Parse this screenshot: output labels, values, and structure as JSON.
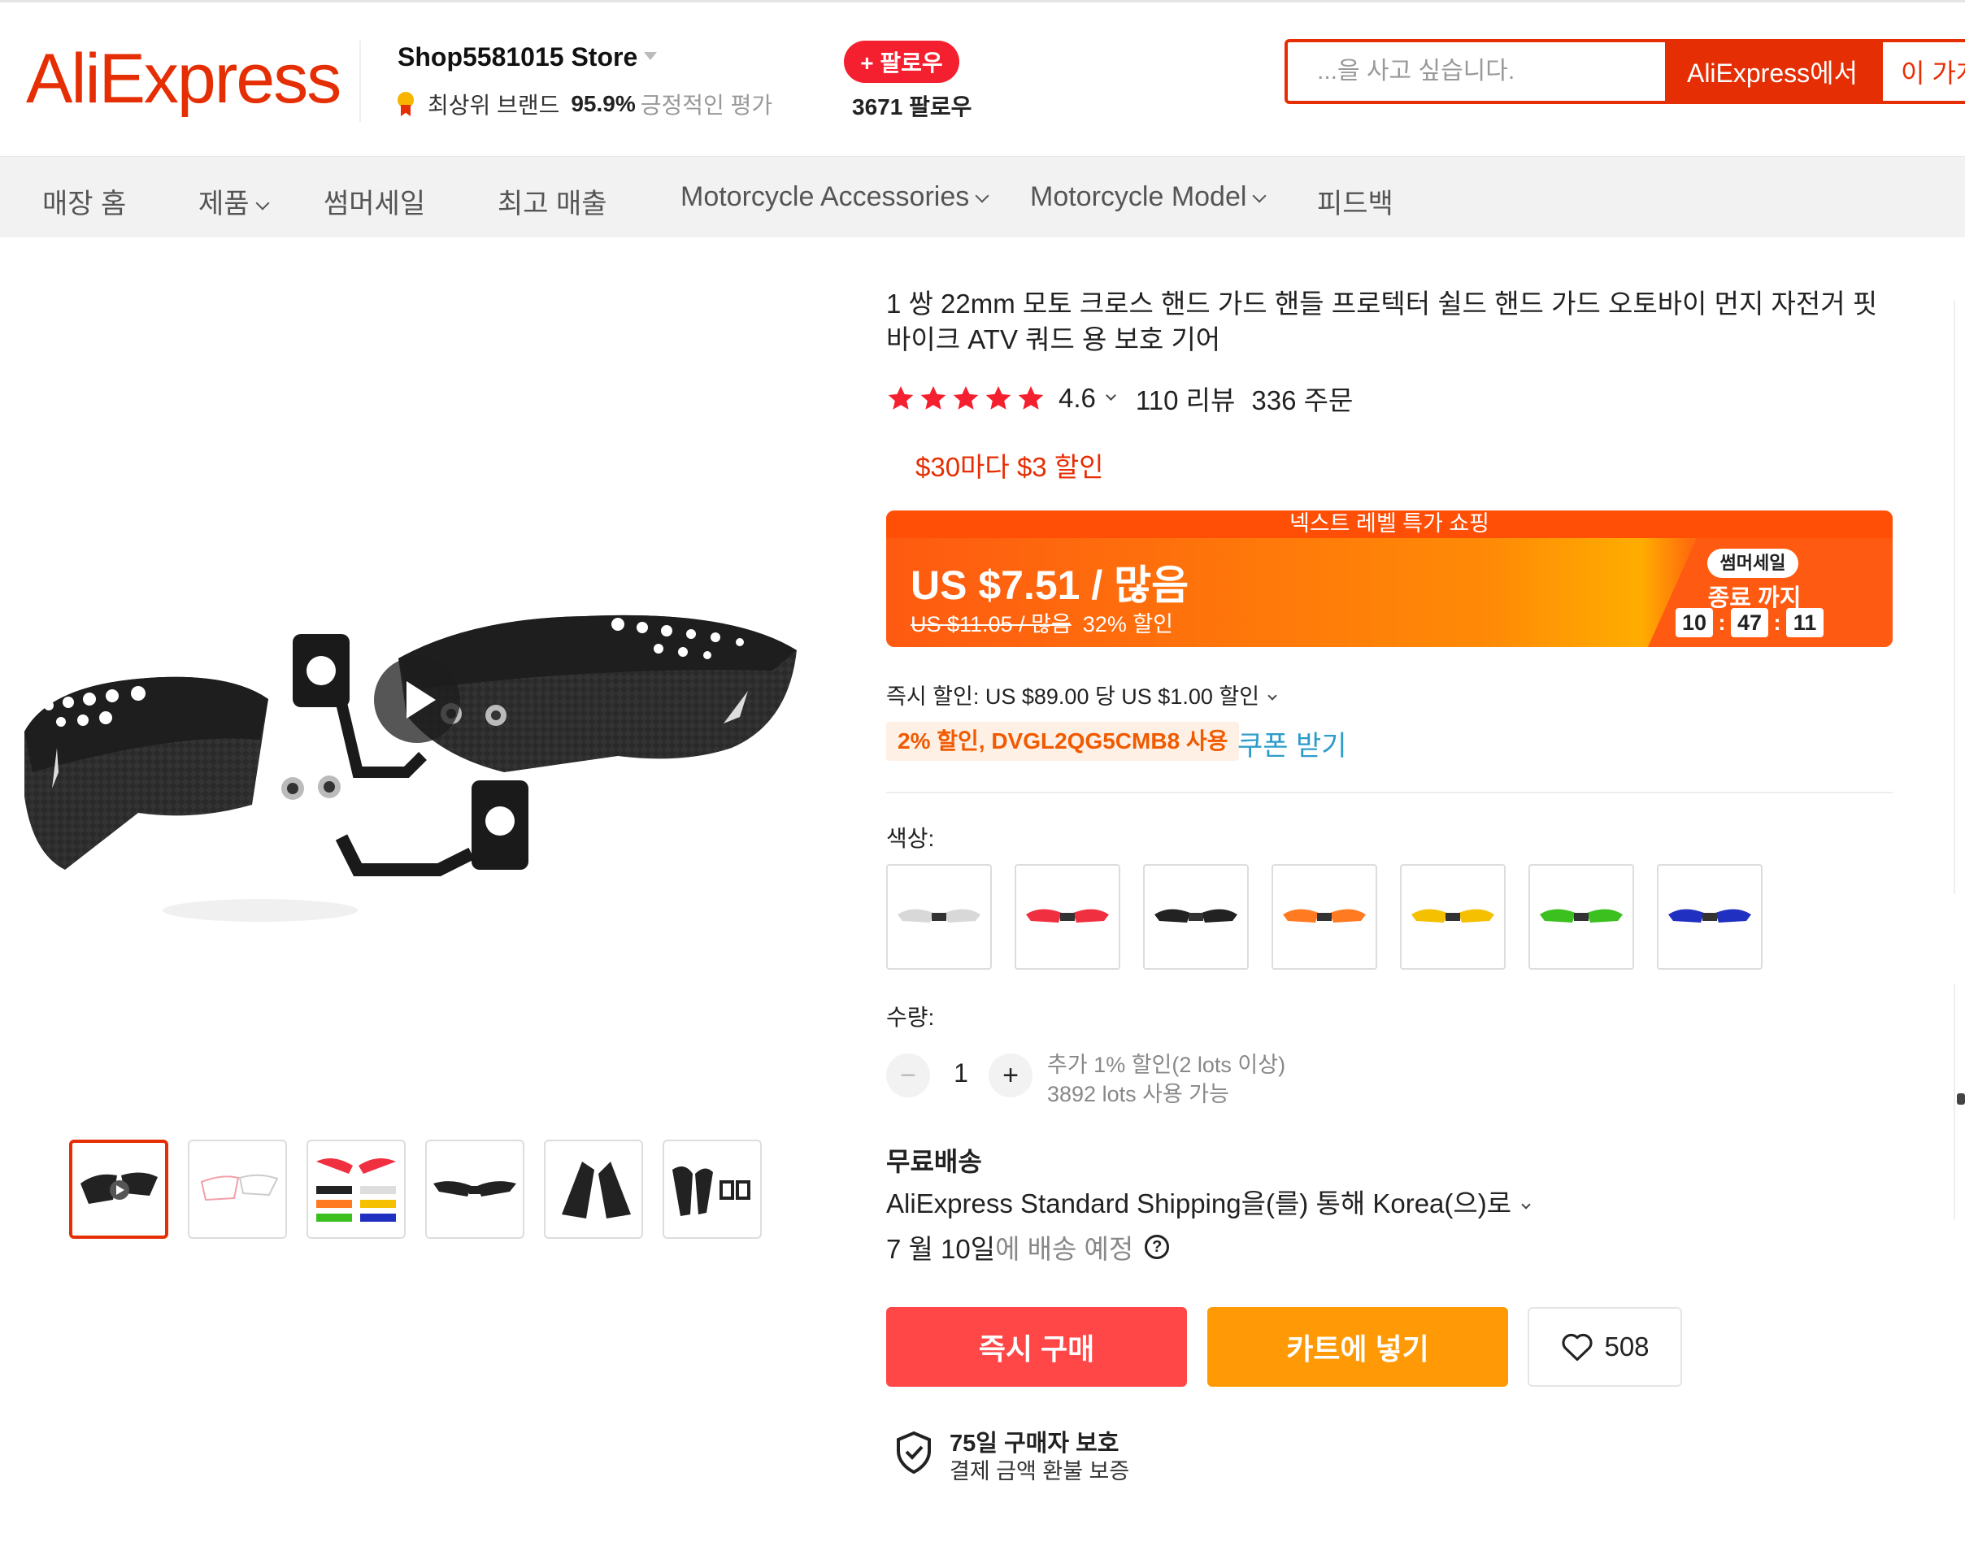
{
  "header": {
    "logo": "AliExpress",
    "store_name": "Shop5581015 Store",
    "brand_badge": "최상위 브랜드",
    "rating_pct": "95.9%",
    "rating_label": "긍정적인 평가",
    "follow_label": "+ 팔로우",
    "followers": "3671 팔로우",
    "search_placeholder": "...을 사고 싶습니다.",
    "search_btn_site": "AliExpress에서",
    "search_btn_store": "이 가게"
  },
  "nav": {
    "items": [
      "매장 홈",
      "제품",
      "썸머세일",
      "최고 매출",
      "Motorcycle Accessories",
      "Motorcycle Model",
      "피드백"
    ]
  },
  "product": {
    "title": "1 쌍 22mm 모토 크로스 핸드 가드 핸들 프로텍터 쉴드 핸드 가드 오토바이 먼지 자전거 핏 바이크 ATV 쿼드 용 보호 기어",
    "rating": "4.6",
    "rating_stars": 5,
    "reviews": "110 리뷰",
    "orders": "336 주문",
    "store_discount": "$30마다 $3 할인",
    "price_banner": "넥스트 레벨 특가 쇼핑",
    "price": "US $7.51 / 많음",
    "old_price": "US $11.05 / 많음",
    "discount_pct": "32% 할인",
    "sale_badge": "썸머세일",
    "sale_ends": "종료 까지",
    "timer": [
      "10",
      "47",
      "11"
    ],
    "instant_discount": "즉시 할인: US $89.00 당 US $1.00 할인",
    "coupon_code": "2% 할인, DVGL2QG5CMB8 사용",
    "coupon_link": "쿠폰 받기",
    "color_label": "색상:",
    "qty_label": "수량:",
    "qty_value": "1",
    "qty_note1": "추가 1% 할인(2 lots 이상)",
    "qty_note2": "3892 lots 사용 가능",
    "shipping_title": "무료배송",
    "shipping_method": "AliExpress Standard Shipping을(를) 통해 Korea(으)로",
    "shipping_date": "7 월 10일",
    "shipping_date_suffix": "에 배송 예정",
    "buy_now": "즉시 구매",
    "add_to_cart": "카트에 넣기",
    "wishlist_count": "508",
    "protection_title": "75일 구매자 보호",
    "protection_sub": "결제 금액 환불 보증"
  },
  "colors": {
    "accent": "#e62e04",
    "swatches": [
      "#e6e6e6",
      "#f03040",
      "#222222",
      "#ff7a20",
      "#f5c000",
      "#3cc020",
      "#2030c0"
    ],
    "buy": "#ff4747",
    "cart": "#ff9a06"
  }
}
